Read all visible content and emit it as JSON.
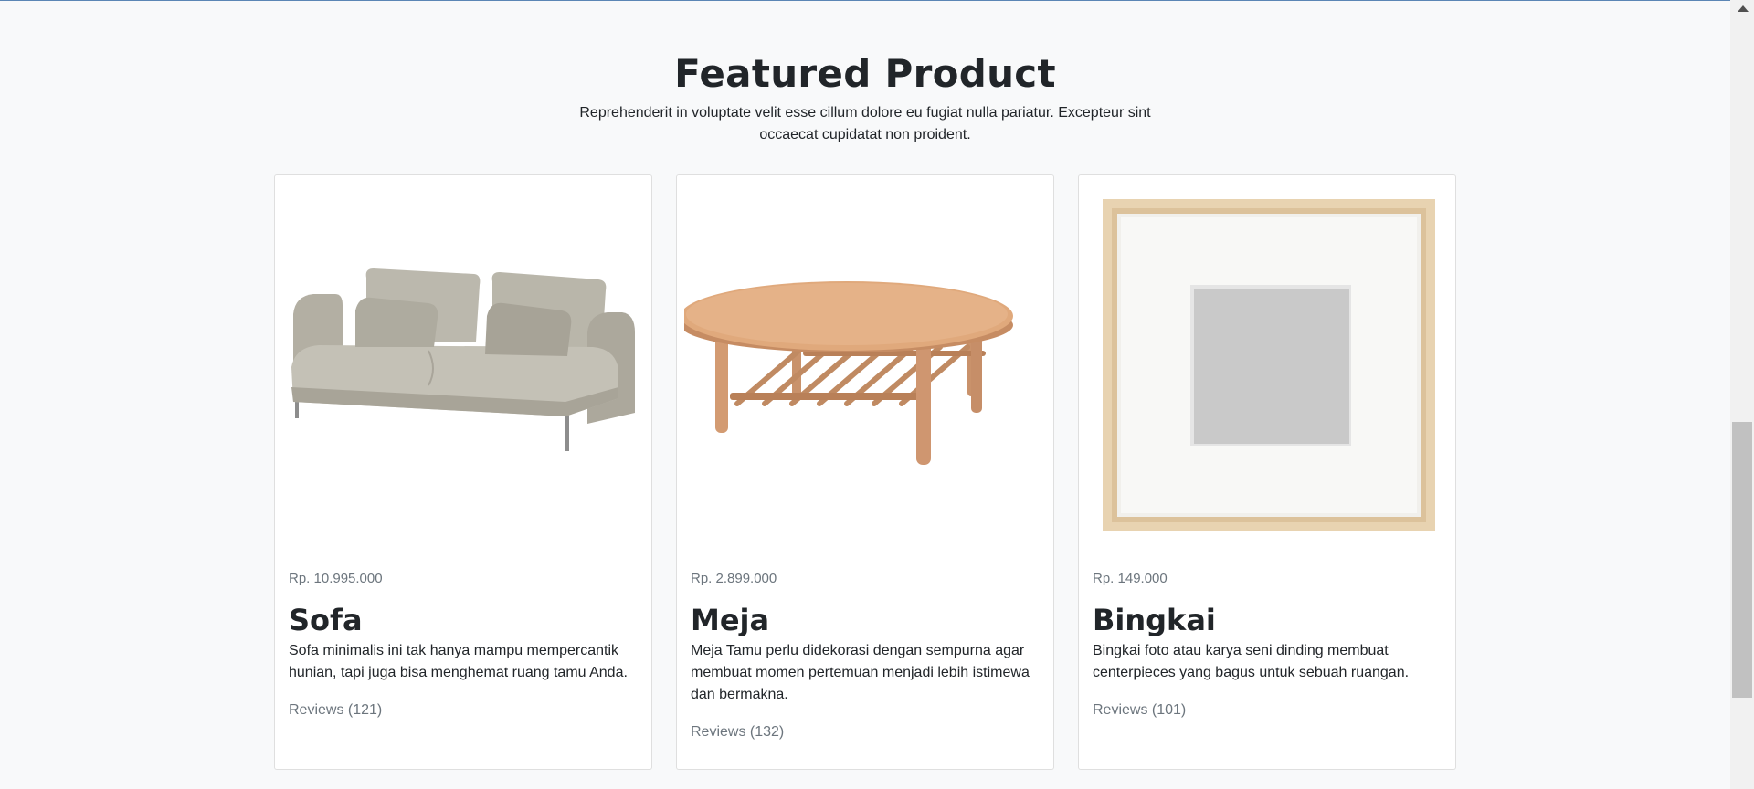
{
  "section": {
    "title": "Featured Product",
    "subtitle": "Reprehenderit in voluptate velit esse cillum dolore eu fugiat nulla pariatur. Excepteur sint occaecat cupidatat non proident."
  },
  "products": [
    {
      "image": "sofa-image",
      "price": "Rp. 10.995.000",
      "name": "Sofa",
      "description": "Sofa minimalis ini tak hanya mampu mempercantik hunian, tapi juga bisa menghemat ruang tamu Anda.",
      "reviews": "Reviews (121)"
    },
    {
      "image": "table-image",
      "price": "Rp. 2.899.000",
      "name": "Meja",
      "description": "Meja Tamu perlu didekorasi dengan sempurna agar membuat momen pertemuan menjadi lebih istimewa dan bermakna.",
      "reviews": "Reviews (132)"
    },
    {
      "image": "frame-image",
      "price": "Rp. 149.000",
      "name": "Bingkai",
      "description": "Bingkai foto atau karya seni dinding membuat centerpieces yang bagus untuk sebuah ruangan.",
      "reviews": "Reviews (101)"
    }
  ],
  "colors": {
    "background": "#f8f9fa",
    "card_background": "#ffffff",
    "muted_text": "#6c757d",
    "heading_text": "#212529"
  }
}
